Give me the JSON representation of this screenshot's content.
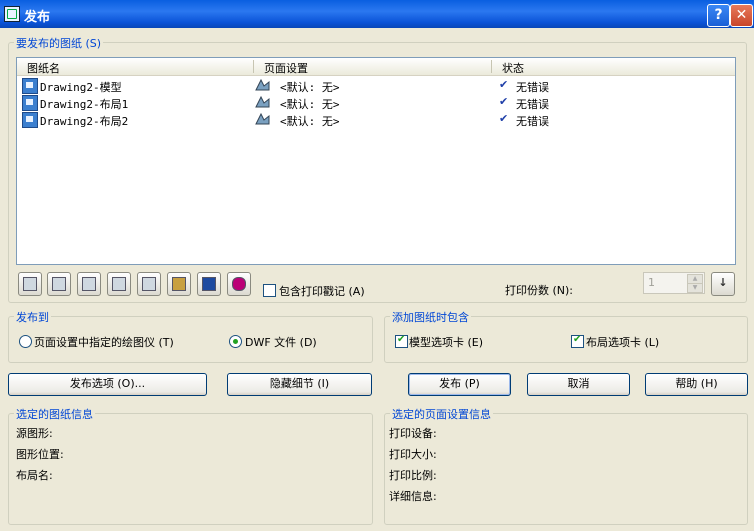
{
  "window": {
    "title": "发布",
    "help_label": "?",
    "close_label": "✕"
  },
  "sheets_group": {
    "label": "要发布的图纸 (S)",
    "columns": [
      "图纸名",
      "页面设置",
      "状态"
    ],
    "rows": [
      {
        "name": "Drawing2-模型",
        "page_setup": "<默认: 无>",
        "status": "无错误"
      },
      {
        "name": "Drawing2-布局1",
        "page_setup": "<默认: 无>",
        "status": "无错误"
      },
      {
        "name": "Drawing2-布局2",
        "page_setup": "<默认: 无>",
        "status": "无错误"
      }
    ],
    "include_stamp_label": "包含打印戳记 (A)",
    "include_stamp_checked": false,
    "copies_label": "打印份数 (N):",
    "copies_value": "1"
  },
  "publish_to": {
    "label": "发布到",
    "option_plotter": "页面设置中指定的绘图仪 (T)",
    "option_dwf": "DWF 文件 (D)",
    "selected": "dwf"
  },
  "include_when_adding": {
    "label": "添加图纸时包含",
    "model_tab_label": "模型选项卡 (E)",
    "model_tab_checked": true,
    "layout_tab_label": "布局选项卡 (L)",
    "layout_tab_checked": true
  },
  "buttons": {
    "publish_options": "发布选项 (O)...",
    "hide_details": "隐藏细节 (I)",
    "publish": "发布 (P)",
    "cancel": "取消",
    "help": "帮助 (H)"
  },
  "selected_sheet_info": {
    "label": "选定的图纸信息",
    "source_drawing": "源图形:",
    "drawing_location": "图形位置:",
    "layout_name": "布局名:"
  },
  "selected_page_setup_info": {
    "label": "选定的页面设置信息",
    "plot_device": "打印设备:",
    "plot_size": "打印大小:",
    "plot_scale": "打印比例:",
    "details": "详细信息:"
  }
}
